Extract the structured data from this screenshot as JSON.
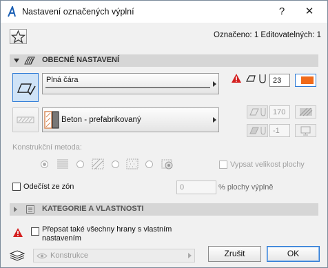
{
  "window": {
    "title": "Nastavení označených výplní",
    "help_label": "?",
    "close_label": "✕"
  },
  "header": {
    "selection_info": "Označeno: 1 Editovatelných: 1"
  },
  "general_section": {
    "title": "OBECNÉ NASTAVENÍ"
  },
  "line_type": {
    "value": "Plná čára"
  },
  "pen": {
    "value": "23"
  },
  "fill_type": {
    "value": "Beton - prefabrikovaný"
  },
  "angle": {
    "value": "170"
  },
  "bg_pen": {
    "value": "-1"
  },
  "construction_method": {
    "label": "Konstrukční metoda:"
  },
  "show_area_checkbox": {
    "label": "Vypsat velikost plochy"
  },
  "subtract_zones": {
    "label": "Odečíst ze zón",
    "value": "0",
    "unit_label": "% plochy výplně"
  },
  "category_section": {
    "title": "KATEGORIE A VLASTNOSTI"
  },
  "override_edges": {
    "label": "Přepsat také všechny hrany s vlastním nastavením"
  },
  "layer": {
    "value": "Konstrukce"
  },
  "footer": {
    "cancel_label": "Zrušit",
    "ok_label": "OK"
  },
  "colors": {
    "accent": "#2e7bd6",
    "warning": "#d41f1f",
    "pen_swatch": "#f06a1a",
    "fill_swatch": "#d98b5a"
  }
}
